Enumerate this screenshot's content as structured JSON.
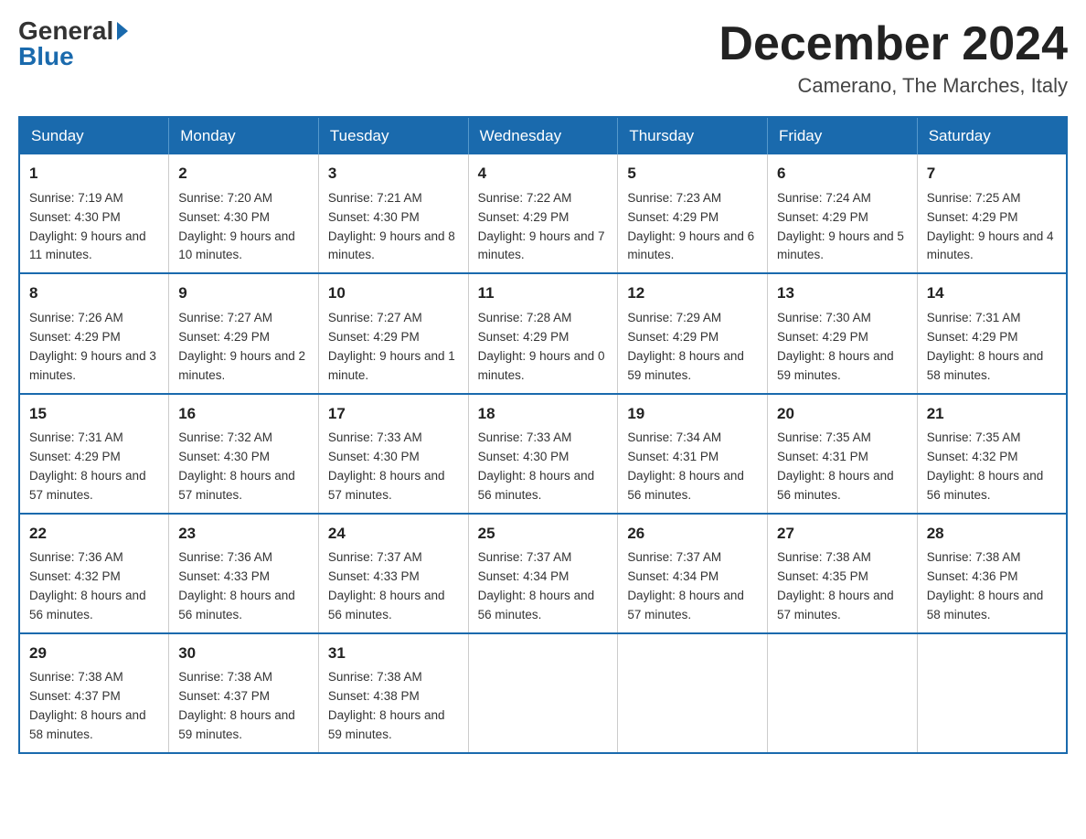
{
  "header": {
    "logo_general": "General",
    "logo_blue": "Blue",
    "month_title": "December 2024",
    "location": "Camerano, The Marches, Italy"
  },
  "days_of_week": [
    "Sunday",
    "Monday",
    "Tuesday",
    "Wednesday",
    "Thursday",
    "Friday",
    "Saturday"
  ],
  "weeks": [
    [
      {
        "day": "1",
        "sunrise": "7:19 AM",
        "sunset": "4:30 PM",
        "daylight": "9 hours and 11 minutes."
      },
      {
        "day": "2",
        "sunrise": "7:20 AM",
        "sunset": "4:30 PM",
        "daylight": "9 hours and 10 minutes."
      },
      {
        "day": "3",
        "sunrise": "7:21 AM",
        "sunset": "4:30 PM",
        "daylight": "9 hours and 8 minutes."
      },
      {
        "day": "4",
        "sunrise": "7:22 AM",
        "sunset": "4:29 PM",
        "daylight": "9 hours and 7 minutes."
      },
      {
        "day": "5",
        "sunrise": "7:23 AM",
        "sunset": "4:29 PM",
        "daylight": "9 hours and 6 minutes."
      },
      {
        "day": "6",
        "sunrise": "7:24 AM",
        "sunset": "4:29 PM",
        "daylight": "9 hours and 5 minutes."
      },
      {
        "day": "7",
        "sunrise": "7:25 AM",
        "sunset": "4:29 PM",
        "daylight": "9 hours and 4 minutes."
      }
    ],
    [
      {
        "day": "8",
        "sunrise": "7:26 AM",
        "sunset": "4:29 PM",
        "daylight": "9 hours and 3 minutes."
      },
      {
        "day": "9",
        "sunrise": "7:27 AM",
        "sunset": "4:29 PM",
        "daylight": "9 hours and 2 minutes."
      },
      {
        "day": "10",
        "sunrise": "7:27 AM",
        "sunset": "4:29 PM",
        "daylight": "9 hours and 1 minute."
      },
      {
        "day": "11",
        "sunrise": "7:28 AM",
        "sunset": "4:29 PM",
        "daylight": "9 hours and 0 minutes."
      },
      {
        "day": "12",
        "sunrise": "7:29 AM",
        "sunset": "4:29 PM",
        "daylight": "8 hours and 59 minutes."
      },
      {
        "day": "13",
        "sunrise": "7:30 AM",
        "sunset": "4:29 PM",
        "daylight": "8 hours and 59 minutes."
      },
      {
        "day": "14",
        "sunrise": "7:31 AM",
        "sunset": "4:29 PM",
        "daylight": "8 hours and 58 minutes."
      }
    ],
    [
      {
        "day": "15",
        "sunrise": "7:31 AM",
        "sunset": "4:29 PM",
        "daylight": "8 hours and 57 minutes."
      },
      {
        "day": "16",
        "sunrise": "7:32 AM",
        "sunset": "4:30 PM",
        "daylight": "8 hours and 57 minutes."
      },
      {
        "day": "17",
        "sunrise": "7:33 AM",
        "sunset": "4:30 PM",
        "daylight": "8 hours and 57 minutes."
      },
      {
        "day": "18",
        "sunrise": "7:33 AM",
        "sunset": "4:30 PM",
        "daylight": "8 hours and 56 minutes."
      },
      {
        "day": "19",
        "sunrise": "7:34 AM",
        "sunset": "4:31 PM",
        "daylight": "8 hours and 56 minutes."
      },
      {
        "day": "20",
        "sunrise": "7:35 AM",
        "sunset": "4:31 PM",
        "daylight": "8 hours and 56 minutes."
      },
      {
        "day": "21",
        "sunrise": "7:35 AM",
        "sunset": "4:32 PM",
        "daylight": "8 hours and 56 minutes."
      }
    ],
    [
      {
        "day": "22",
        "sunrise": "7:36 AM",
        "sunset": "4:32 PM",
        "daylight": "8 hours and 56 minutes."
      },
      {
        "day": "23",
        "sunrise": "7:36 AM",
        "sunset": "4:33 PM",
        "daylight": "8 hours and 56 minutes."
      },
      {
        "day": "24",
        "sunrise": "7:37 AM",
        "sunset": "4:33 PM",
        "daylight": "8 hours and 56 minutes."
      },
      {
        "day": "25",
        "sunrise": "7:37 AM",
        "sunset": "4:34 PM",
        "daylight": "8 hours and 56 minutes."
      },
      {
        "day": "26",
        "sunrise": "7:37 AM",
        "sunset": "4:34 PM",
        "daylight": "8 hours and 57 minutes."
      },
      {
        "day": "27",
        "sunrise": "7:38 AM",
        "sunset": "4:35 PM",
        "daylight": "8 hours and 57 minutes."
      },
      {
        "day": "28",
        "sunrise": "7:38 AM",
        "sunset": "4:36 PM",
        "daylight": "8 hours and 58 minutes."
      }
    ],
    [
      {
        "day": "29",
        "sunrise": "7:38 AM",
        "sunset": "4:37 PM",
        "daylight": "8 hours and 58 minutes."
      },
      {
        "day": "30",
        "sunrise": "7:38 AM",
        "sunset": "4:37 PM",
        "daylight": "8 hours and 59 minutes."
      },
      {
        "day": "31",
        "sunrise": "7:38 AM",
        "sunset": "4:38 PM",
        "daylight": "8 hours and 59 minutes."
      },
      null,
      null,
      null,
      null
    ]
  ]
}
